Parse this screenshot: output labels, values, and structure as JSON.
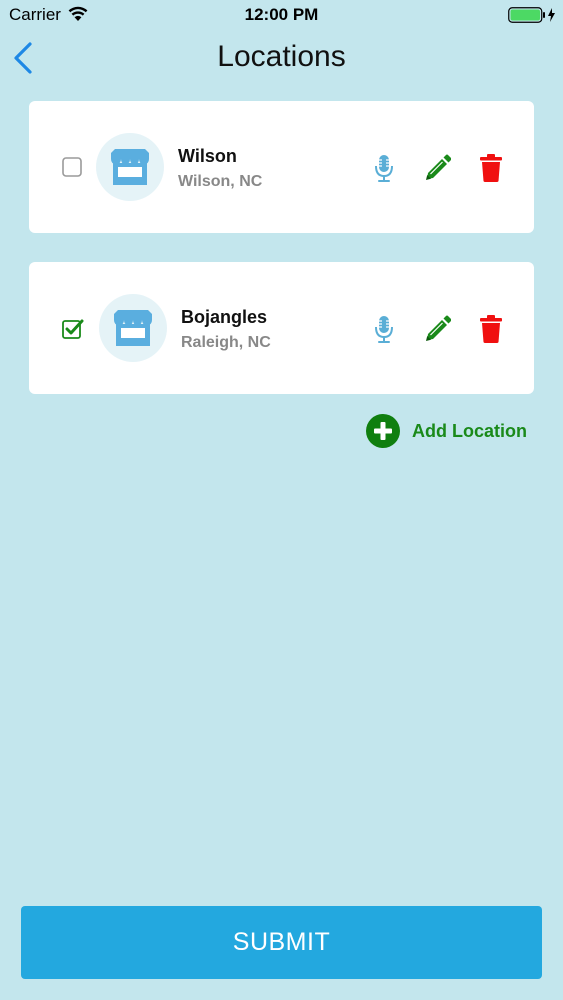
{
  "status_bar": {
    "carrier": "Carrier",
    "time": "12:00 PM"
  },
  "nav": {
    "title": "Locations"
  },
  "locations": [
    {
      "name": "Wilson",
      "subtitle": "Wilson, NC",
      "checked": false
    },
    {
      "name": "Bojangles",
      "subtitle": "Raleigh, NC",
      "checked": true
    }
  ],
  "add_location": {
    "label": "Add Location"
  },
  "submit": {
    "label": "SUBMIT"
  },
  "icons": {
    "back": "chevron-left-icon",
    "store": "store-icon",
    "mic": "microphone-icon",
    "edit": "pencil-icon",
    "delete": "trash-icon",
    "add": "plus-circle-icon",
    "checkbox_checked": "checkbox-checked-icon",
    "checkbox_unchecked": "checkbox-unchecked-icon"
  },
  "colors": {
    "background": "#c3e6ed",
    "accent_blue": "#23a8df",
    "nav_blue": "#1e88e5",
    "mic_blue": "#5aaed6",
    "edit_green": "#1a8a1a",
    "delete_red": "#f01010",
    "store_blue": "#5aaedf",
    "battery_green": "#4cd964"
  }
}
